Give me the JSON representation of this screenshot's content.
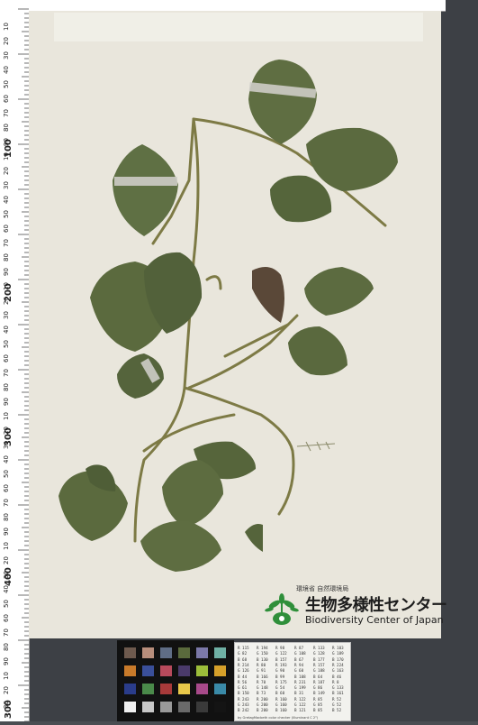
{
  "ruler": {
    "big_labels": [
      "100",
      "200",
      "300",
      "400",
      "300"
    ],
    "small_labels": [
      "10",
      "20",
      "30",
      "40",
      "50",
      "60",
      "70",
      "80",
      "90",
      "10",
      "20",
      "30",
      "40",
      "50",
      "60",
      "70",
      "80",
      "90",
      "10",
      "20",
      "30",
      "40",
      "50",
      "60",
      "70",
      "80",
      "90",
      "10",
      "20",
      "30",
      "40",
      "50",
      "60",
      "70",
      "80",
      "90",
      "10",
      "20",
      "30",
      "40",
      "50",
      "60",
      "70",
      "80",
      "90",
      "10",
      "20",
      "30",
      "40",
      "50",
      "60",
      "70",
      "80",
      "90"
    ]
  },
  "logo": {
    "ministry": "環境省 自然環境局",
    "name_jp": "生物多様性センター",
    "name_en": "Biodiversity Center of Japan",
    "mark_color": "#2f8f3a"
  },
  "color_card": {
    "swatches": [
      "#6e5a4e",
      "#b88e7c",
      "#5f6d86",
      "#5a6a3c",
      "#7b78a8",
      "#6fb0a4",
      "#c87a2a",
      "#3a4f9a",
      "#b84a5c",
      "#4a3a6a",
      "#9cbe3a",
      "#d6a02a",
      "#2a3c8a",
      "#4a8a4a",
      "#a83a3a",
      "#e8c84a",
      "#a84a8a",
      "#3a8aa8",
      "#f0f0f0",
      "#c8c8c8",
      "#9a9a9a",
      "#6a6a6a",
      "#3a3a3a",
      "#141414"
    ]
  },
  "data_card": {
    "rows": [
      [
        "R 115",
        "R 194",
        "R 98",
        "R 87",
        "R 133",
        "R 103"
      ],
      [
        "G 82",
        "G 150",
        "G 122",
        "G 108",
        "G 128",
        "G 189"
      ],
      [
        "B 68",
        "B 130",
        "B 157",
        "B 67",
        "B 177",
        "B 170"
      ],
      [
        "R 214",
        "R 80",
        "R 193",
        "R 94",
        "R 157",
        "R 224"
      ],
      [
        "G 126",
        "G 91",
        "G 90",
        "G 60",
        "G 188",
        "G 163"
      ],
      [
        "B 44",
        "B 166",
        "B 99",
        "B 108",
        "B 64",
        "B 46"
      ],
      [
        "R 56",
        "R 70",
        "R 175",
        "R 231",
        "R 187",
        "R 8"
      ],
      [
        "G 61",
        "G 148",
        "G 54",
        "G 199",
        "G 86",
        "G 133"
      ],
      [
        "B 150",
        "B 73",
        "B 60",
        "B 31",
        "B 149",
        "B 161"
      ],
      [
        "R 243",
        "R 200",
        "R 160",
        "R 122",
        "R 85",
        "R 52"
      ],
      [
        "G 243",
        "G 200",
        "G 160",
        "G 122",
        "G 85",
        "G 52"
      ],
      [
        "B 242",
        "B 200",
        "B 160",
        "B 121",
        "B 85",
        "B 52"
      ]
    ],
    "footer": "by GretagMacbeth color checker (Illuminant C 2°)"
  },
  "colors": {
    "sheet": "#e9e6dc",
    "leaf": "#5b6b3e",
    "leaf_dark": "#4a5a32",
    "stem": "#7d7a45"
  }
}
